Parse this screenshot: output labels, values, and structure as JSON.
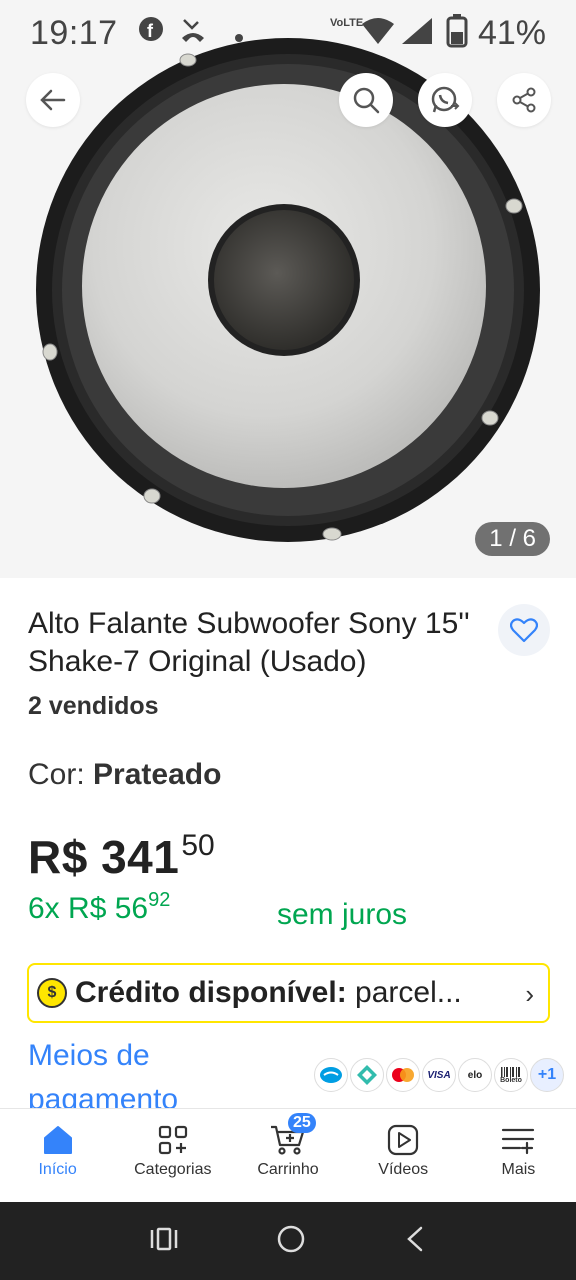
{
  "status_bar": {
    "time": "19:17",
    "battery": "41%",
    "net_label": "VoLTE"
  },
  "gallery": {
    "counter": "1 / 6"
  },
  "product": {
    "title": "Alto Falante Subwoofer Sony 15'' Shake-7 Original (Usado)",
    "sold": "2 vendidos",
    "color_label": "Cor:",
    "color_value": "Prateado",
    "price_main": "R$ 341",
    "price_cents": "50",
    "installments_count": "6x",
    "installment_value": "R$ 56",
    "installment_cents": "92",
    "no_interest": "sem juros"
  },
  "credit": {
    "label": "Crédito disponível:",
    "text": "parcel..."
  },
  "payment": {
    "link": "Meios de pagamento",
    "more": "+1",
    "methods": [
      "mercado-pago",
      "pix",
      "mastercard",
      "VISA",
      "elo",
      "Boleto"
    ]
  },
  "nav": {
    "items": [
      {
        "label": "Início",
        "icon": "home-icon"
      },
      {
        "label": "Categorias",
        "icon": "categories-icon"
      },
      {
        "label": "Carrinho",
        "icon": "cart-icon"
      },
      {
        "label": "Vídeos",
        "icon": "video-icon"
      },
      {
        "label": "Mais",
        "icon": "menu-icon"
      }
    ],
    "cart_count": "25"
  },
  "colors": {
    "accent": "#3483fa",
    "green": "#00a650",
    "yellow": "#ffe600"
  }
}
